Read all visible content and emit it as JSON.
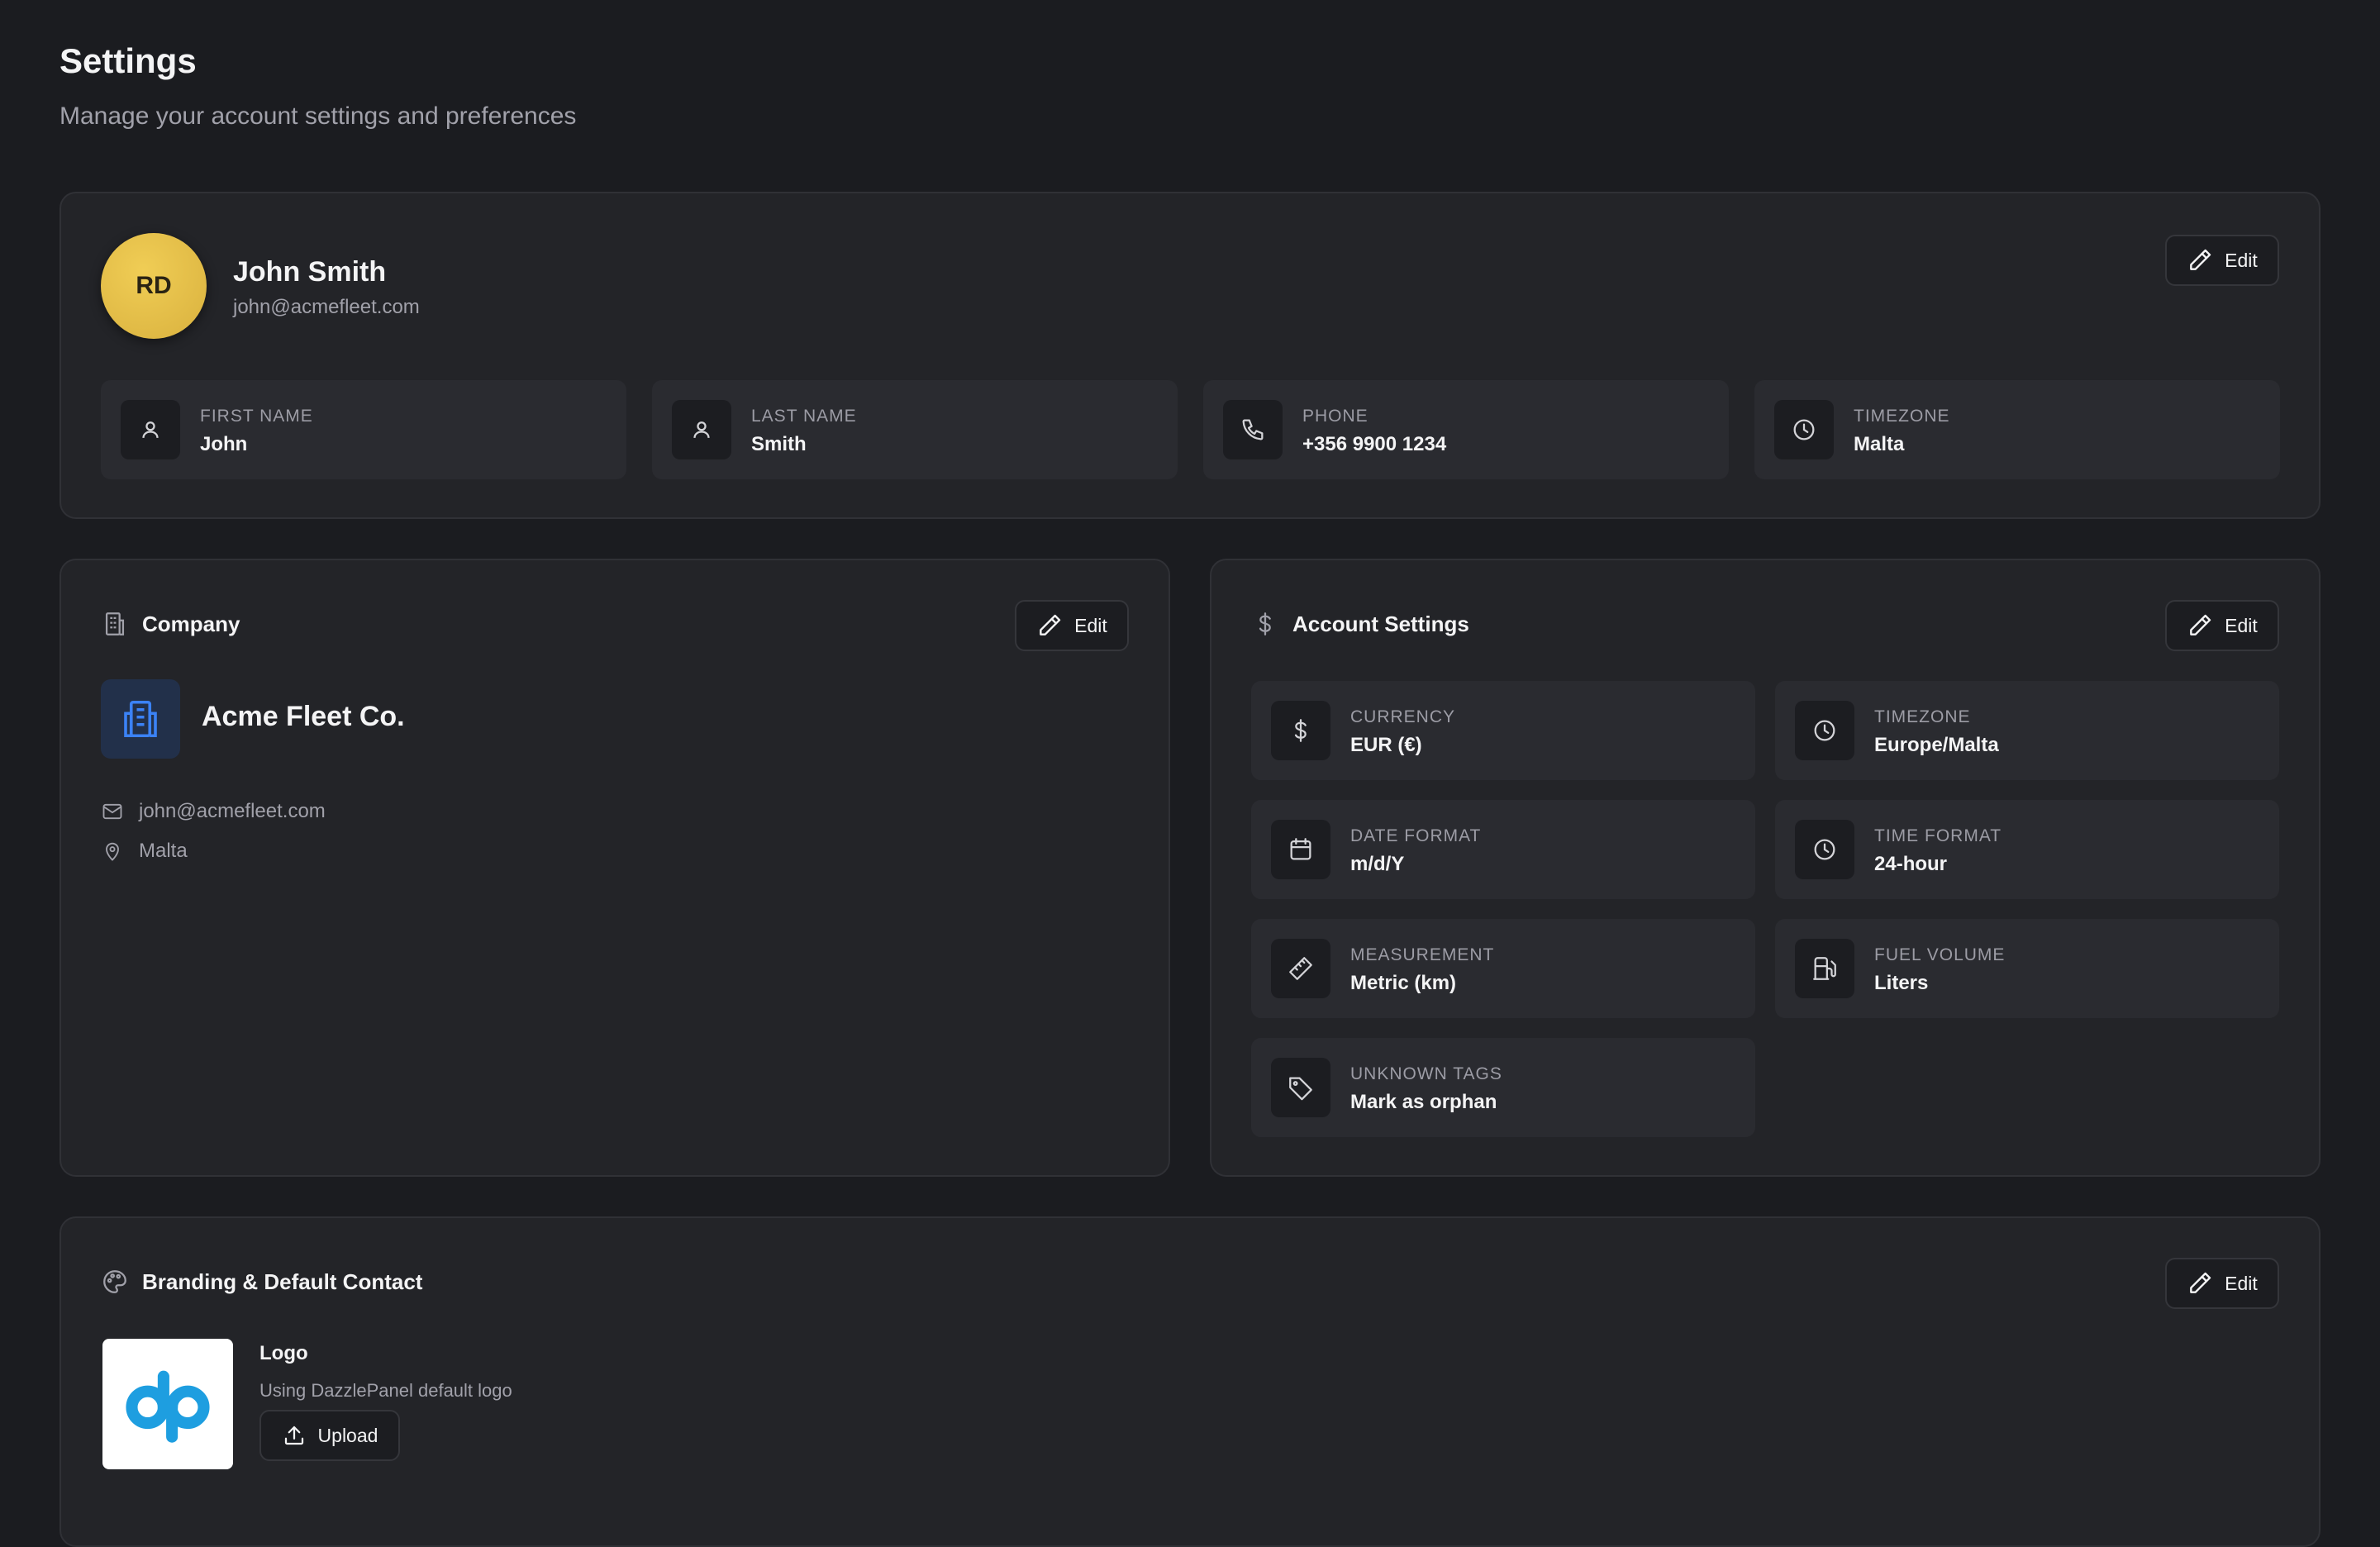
{
  "header": {
    "title": "Settings",
    "subtitle": "Manage your account settings and preferences"
  },
  "profile": {
    "initials": "RD",
    "name": "John Smith",
    "email": "john@acmefleet.com",
    "edit_label": "Edit",
    "fields": [
      {
        "label": "FIRST NAME",
        "value": "John",
        "icon": "user-icon"
      },
      {
        "label": "LAST NAME",
        "value": "Smith",
        "icon": "user-icon"
      },
      {
        "label": "PHONE",
        "value": "+356 9900 1234",
        "icon": "phone-icon"
      },
      {
        "label": "TIMEZONE",
        "value": "Malta",
        "icon": "clock-icon"
      }
    ]
  },
  "company": {
    "title": "Company",
    "edit_label": "Edit",
    "name": "Acme Fleet Co.",
    "email": "john@acmefleet.com",
    "location": "Malta"
  },
  "account": {
    "title": "Account Settings",
    "edit_label": "Edit",
    "fields": [
      {
        "label": "CURRENCY",
        "value": "EUR (€)",
        "icon": "dollar-icon"
      },
      {
        "label": "TIMEZONE",
        "value": "Europe/Malta",
        "icon": "clock-icon"
      },
      {
        "label": "DATE FORMAT",
        "value": "m/d/Y",
        "icon": "calendar-icon"
      },
      {
        "label": "TIME FORMAT",
        "value": "24-hour",
        "icon": "clock-icon"
      },
      {
        "label": "MEASUREMENT",
        "value": "Metric (km)",
        "icon": "ruler-icon"
      },
      {
        "label": "FUEL VOLUME",
        "value": "Liters",
        "icon": "fuel-icon"
      },
      {
        "label": "UNKNOWN TAGS",
        "value": "Mark as orphan",
        "icon": "tag-icon"
      }
    ]
  },
  "branding": {
    "title": "Branding & Default Contact",
    "edit_label": "Edit",
    "logo_label": "Logo",
    "logo_desc": "Using DazzlePanel default logo",
    "upload_label": "Upload"
  },
  "colors": {
    "background": "#1b1c20",
    "card": "#232428",
    "avatar": "#e6bf47",
    "brand_blue": "#1e9ee0",
    "company_icon": "#3b82f6"
  }
}
